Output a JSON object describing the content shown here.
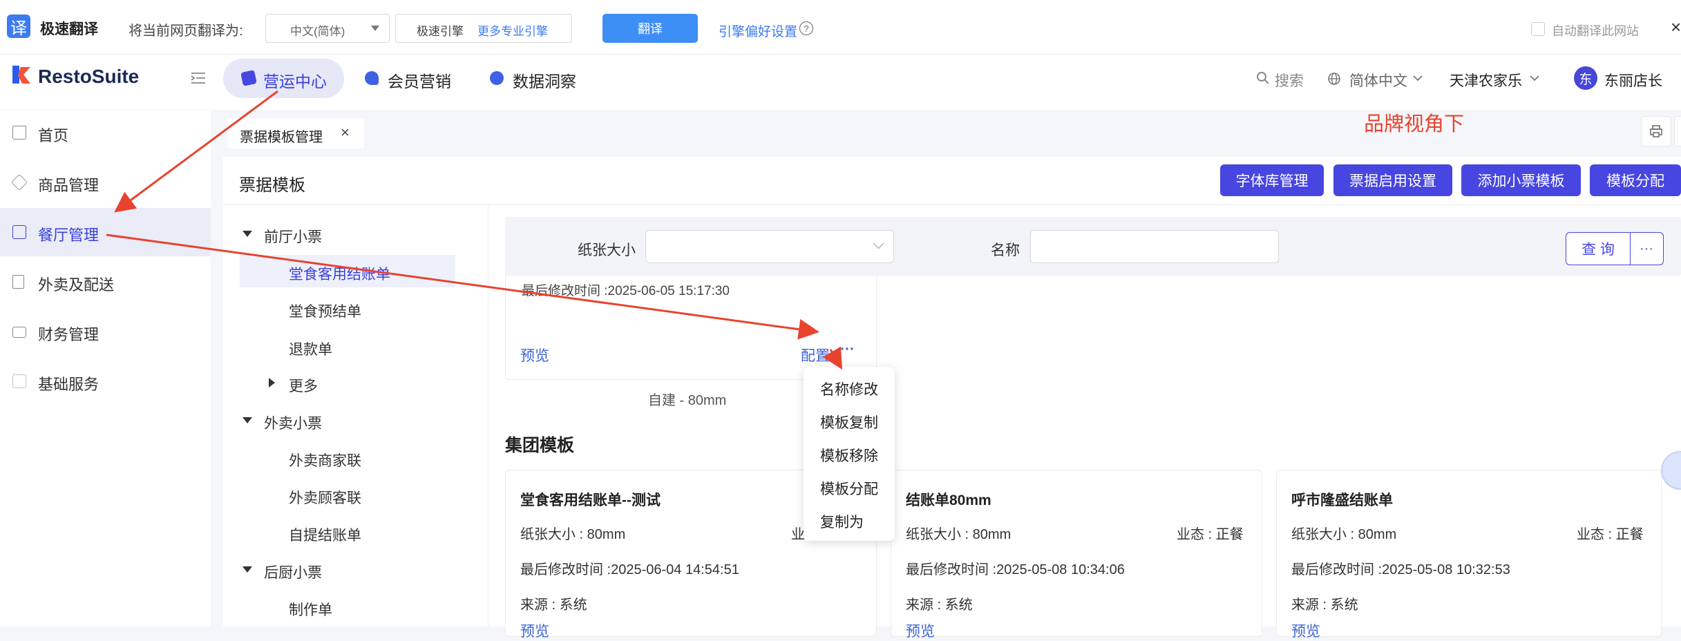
{
  "translate_bar": {
    "logo": "译",
    "name": "极速翻译",
    "label": "将当前网页翻译为:",
    "language": "中文(简体)",
    "engine": "极速引擎",
    "engine_more": "更多专业引擎",
    "translate_button": "翻译",
    "preference": "引擎偏好设置",
    "help": "?",
    "auto_translate": "自动翻译此网站",
    "close": "×"
  },
  "header": {
    "brand": "RestoSuite",
    "nav": [
      "营运中心",
      "会员营销",
      "数据洞察"
    ],
    "search": "搜索",
    "language": "简体中文",
    "store": "天津农家乐",
    "avatar": "东",
    "user": "东丽店长"
  },
  "sidebar": {
    "items": [
      "首页",
      "商品管理",
      "餐厅管理",
      "外卖及配送",
      "财务管理",
      "基础服务"
    ]
  },
  "tabs": {
    "current": "票据模板管理",
    "close": "×"
  },
  "annotation": "品牌视角下",
  "page": {
    "title": "票据模板",
    "buttons": [
      "字体库管理",
      "票据启用设置",
      "添加小票模板",
      "模板分配"
    ]
  },
  "tree": {
    "groups": [
      {
        "label": "前厅小票",
        "children": [
          "堂食客用结账单",
          "堂食预结单",
          "退款单"
        ],
        "more": "更多"
      },
      {
        "label": "外卖小票",
        "children": [
          "外卖商家联",
          "外卖顾客联",
          "自提结账单"
        ]
      },
      {
        "label": "后厨小票",
        "children": [
          "制作单"
        ]
      }
    ]
  },
  "filter": {
    "paper_label": "纸张大小",
    "name_label": "名称",
    "query": "查 询",
    "more": "···"
  },
  "custom_card": {
    "cut_text": "最后修改时间 :2025-06-05 15:17:30",
    "preview": "预览",
    "config": "配置",
    "more": "···",
    "caption": "自建 - 80mm"
  },
  "menu": {
    "items": [
      "名称修改",
      "模板复制",
      "模板移除",
      "模板分配",
      "复制为"
    ]
  },
  "group_section": {
    "title": "集团模板",
    "cards": [
      {
        "title": "堂食客用结账单--测试",
        "paper": "纸张大小 : 80mm",
        "biz": "业",
        "modified": "最后修改时间 :2025-06-04 14:54:51",
        "source": "来源 : 系统",
        "cut": "预览"
      },
      {
        "title": "结账单80mm",
        "paper": "纸张大小 : 80mm",
        "biz": "业态 : 正餐",
        "modified": "最后修改时间 :2025-05-08 10:34:06",
        "source": "来源 : 系统",
        "cut": "预览"
      },
      {
        "title": "呼市隆盛结账单",
        "paper": "纸张大小 : 80mm",
        "biz": "业态 : 正餐",
        "modified": "最后修改时间 :2025-05-08 10:32:53",
        "source": "来源 : 系统",
        "cut": "预览"
      }
    ]
  },
  "colors": {
    "accent": "#4746e0",
    "annotation_red": "#e8432f",
    "link": "#3a62d9"
  }
}
